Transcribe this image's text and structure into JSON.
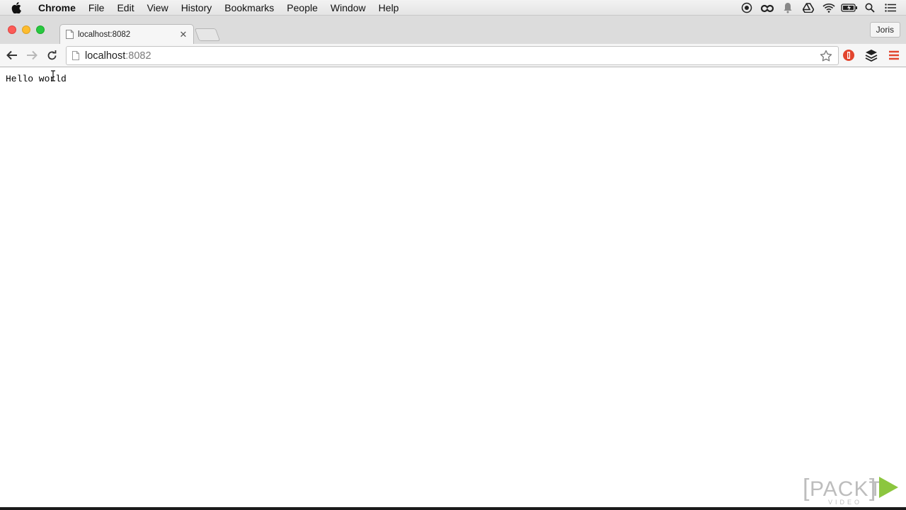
{
  "menubar": {
    "items": [
      "Chrome",
      "File",
      "Edit",
      "View",
      "History",
      "Bookmarks",
      "People",
      "Window",
      "Help"
    ],
    "status_icons": [
      "record-icon",
      "creative-cloud-icon",
      "bell-icon",
      "drive-icon",
      "wifi-icon",
      "battery-icon",
      "spotlight-icon",
      "notification-list-icon"
    ]
  },
  "tab": {
    "title": "localhost:8082"
  },
  "toolbar": {
    "url_host": "localhost",
    "url_port": ":8082"
  },
  "profile": {
    "name": "Joris"
  },
  "page": {
    "text": "Hello world"
  },
  "watermark": {
    "brand": "PACKT",
    "sub": "VIDEO"
  },
  "colors": {
    "tl_close": "#fc5b57",
    "tl_min": "#fdbc2e",
    "tl_max": "#27c840",
    "menu_icon_red": "#e2452e",
    "packt_green": "#8cc63f"
  }
}
